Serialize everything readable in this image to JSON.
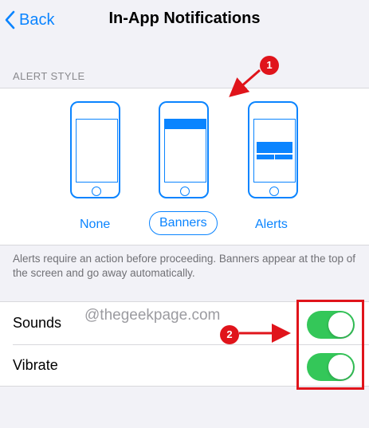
{
  "nav": {
    "back_label": "Back",
    "title": "In-App Notifications"
  },
  "alert_style": {
    "header": "ALERT STYLE",
    "options": [
      {
        "label": "None",
        "selected": false
      },
      {
        "label": "Banners",
        "selected": true
      },
      {
        "label": "Alerts",
        "selected": false
      }
    ],
    "footer": "Alerts require an action before proceeding. Banners appear at the top of the screen and go away automatically."
  },
  "toggles": [
    {
      "label": "Sounds",
      "on": true
    },
    {
      "label": "Vibrate",
      "on": true
    }
  ],
  "watermark": "@thegeekpage.com",
  "annotations": {
    "marker_1": "1",
    "marker_2": "2"
  },
  "colors": {
    "accent": "#0a84ff",
    "switch_on": "#34c759",
    "annotation": "#e0141b",
    "background": "#f2f2f7"
  }
}
